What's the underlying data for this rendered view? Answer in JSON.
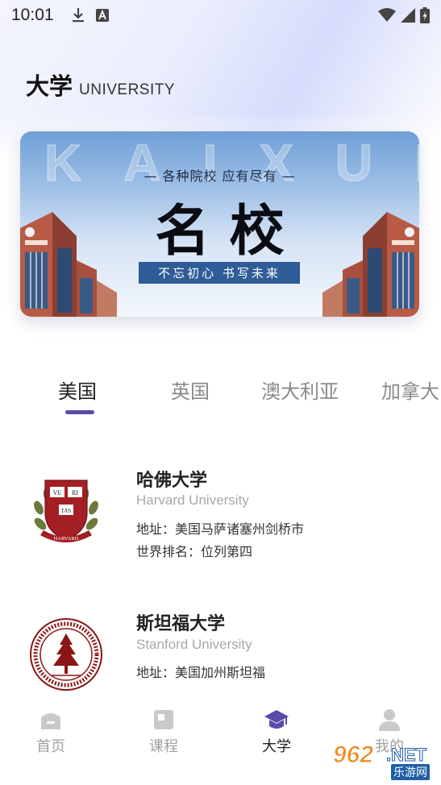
{
  "status_bar": {
    "time": "10:01",
    "left_icons": [
      "download-icon",
      "a-badge-icon"
    ],
    "right_icons": [
      "wifi-icon",
      "signal-icon",
      "battery-icon"
    ]
  },
  "header": {
    "title_cn": "大学",
    "title_en": "UNIVERSITY"
  },
  "banner": {
    "watermark": "KAIXUE",
    "subtitle": "— 各种院校 应有尽有 —",
    "main_text": "名校",
    "slogan": "不忘初心 书写未来"
  },
  "tabs": [
    {
      "label": "美国",
      "active": true
    },
    {
      "label": "英国",
      "active": false
    },
    {
      "label": "澳大利亚",
      "active": false
    },
    {
      "label": "加拿大",
      "active": false
    }
  ],
  "universities": [
    {
      "name": "哈佛大学",
      "name_en": "Harvard University",
      "address": "地址：美国马萨诸塞州剑桥市",
      "ranking": "世界排名：位列第四",
      "logo": "harvard-crest-icon",
      "logo_text": [
        "VE",
        "RI",
        "TAS",
        "HARVARD"
      ]
    },
    {
      "name": "斯坦福大学",
      "name_en": "Stanford University",
      "address": "地址：美国加州斯坦福",
      "logo": "stanford-seal-icon"
    }
  ],
  "bottom_nav": [
    {
      "label": "首页",
      "icon": "home-icon",
      "active": false
    },
    {
      "label": "课程",
      "icon": "course-icon",
      "active": false
    },
    {
      "label": "大学",
      "icon": "graduation-cap-icon",
      "active": true
    },
    {
      "label": "我的",
      "icon": "profile-icon",
      "active": false
    }
  ],
  "watermark": {
    "number": "962",
    "net": ".NET",
    "cn": "乐游网"
  },
  "colors": {
    "accent": "#5a4aa8",
    "slogan_bg": "#2f5c96",
    "inactive_text": "#8a8a8a",
    "harvard_red": "#a31f24",
    "stanford_red": "#8c1515"
  }
}
